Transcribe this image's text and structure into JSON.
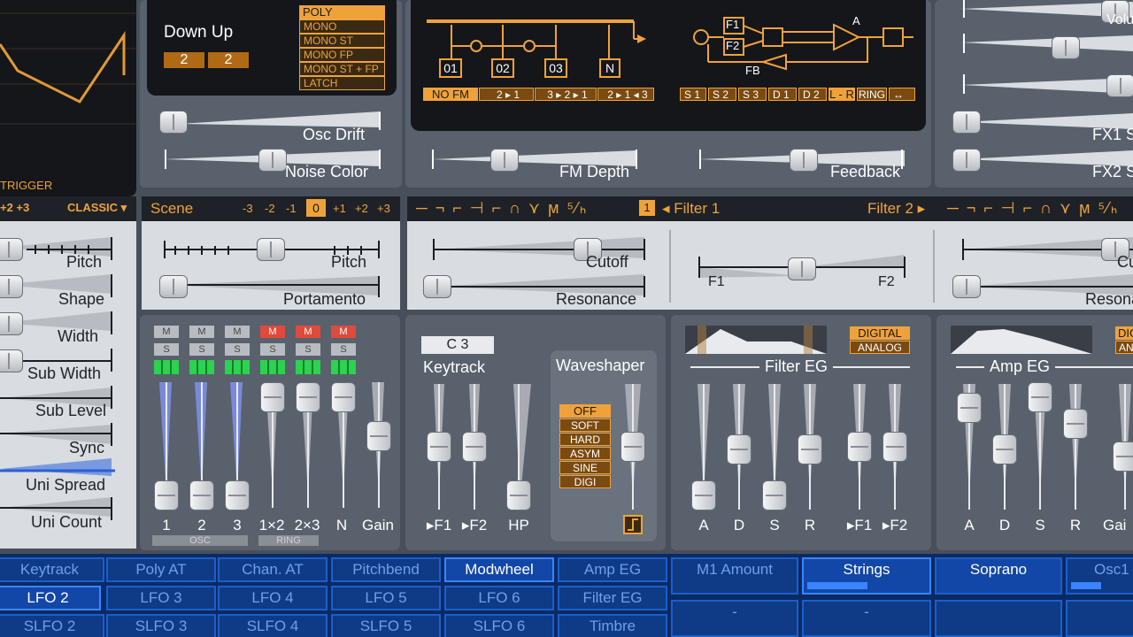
{
  "osc_display": {
    "trigger_label": "TRIGGER"
  },
  "playmode": {
    "title": "Down Up",
    "values": [
      "2",
      "2"
    ],
    "modes": [
      "POLY",
      "MONO",
      "MONO ST",
      "MONO FP",
      "MONO ST + FP",
      "LATCH"
    ],
    "selected": "POLY"
  },
  "osc_sliders": {
    "drift_label": "Osc Drift",
    "noise_label": "Noise Color"
  },
  "fm": {
    "routing": [
      "NO FM",
      "2 ▸ 1",
      "3 ▸ 2 ▸ 1",
      "2 ▸ 1 ◂ 3"
    ],
    "osc_boxes": [
      "01",
      "02",
      "03",
      "N"
    ],
    "filter_config": [
      "S 1",
      "S 2",
      "S 3",
      "D 1",
      "D 2",
      "L - R",
      "RING",
      "↔"
    ],
    "f1": "F1",
    "f2": "F2",
    "fb": "FB",
    "a": "A",
    "depth_label": "FM Depth",
    "feedback_label": "Feedback"
  },
  "right_fx": {
    "labels": [
      "Volu",
      "FX1 S",
      "FX2 S"
    ]
  },
  "left_strip": {
    "octave": "+2 +3",
    "type": "CLASSIC ▾",
    "sliders": [
      "Pitch",
      "Shape",
      "Width",
      "Sub Width",
      "Sub Level",
      "Sync",
      "Uni Spread",
      "Uni Count"
    ]
  },
  "scene": {
    "title": "Scene",
    "octaves": [
      "-3",
      "-2",
      "-1",
      "0",
      "+1",
      "+2",
      "+3"
    ],
    "selected": "0",
    "pitch_label": "Pitch",
    "portamento_label": "Portamento"
  },
  "filter_bar": {
    "filter1_icons": "─ ¬ ⌐ ⊣ ⌐ ∩ ⋎ ϻ ⁵⁄ₕ",
    "num": "1",
    "filter1_label": "◂ Filter 1",
    "filter2_label": "Filter 2 ▸",
    "filter2_icons": "─ ¬ ⌐ ⊣ ⌐ ∩ ⋎ ϻ ⁵⁄ₕ",
    "cutoff_label": "Cutoff",
    "resonance_label": "Resonance",
    "f1": "F1",
    "f2": "F2",
    "cutoff2_label": "Cu",
    "resonance2_label": "Resona"
  },
  "mixer": {
    "m_labels": [
      "M",
      "M",
      "M",
      "M",
      "M",
      "M"
    ],
    "s_labels": [
      "S",
      "S",
      "S",
      "S",
      "S",
      "S"
    ],
    "channels": [
      "1",
      "2",
      "3",
      "1×2",
      "2×3",
      "N",
      "Gain"
    ],
    "group1": "OSC",
    "group2": "RING"
  },
  "keytrack": {
    "note": "C 3",
    "title": "Keytrack",
    "labels": [
      "▸F1",
      "▸F2",
      "HP"
    ]
  },
  "waveshaper": {
    "title": "Waveshaper",
    "modes": [
      "OFF",
      "SOFT",
      "HARD",
      "ASYM",
      "SINE",
      "DIGI"
    ],
    "selected": "OFF"
  },
  "filter_eg": {
    "title": "Filter EG",
    "modes": [
      "DIGITAL",
      "ANALOG"
    ],
    "labels": [
      "A",
      "D",
      "S",
      "R",
      "▸F1",
      "▸F2"
    ]
  },
  "amp_eg": {
    "title": "Amp EG",
    "modes": [
      "DIGI",
      "AN"
    ],
    "labels": [
      "A",
      "D",
      "S",
      "R",
      "Gai"
    ]
  },
  "mod_matrix": {
    "row1": [
      "Keytrack",
      "Poly AT",
      "Chan. AT",
      "Pitchbend",
      "Modwheel",
      "Amp EG",
      "M1 Amount",
      "Strings",
      "Soprano",
      "Osc1"
    ],
    "row2": [
      "LFO 2",
      "LFO 3",
      "LFO 4",
      "LFO 5",
      "LFO 6",
      "Filter EG"
    ],
    "row3": [
      "SLFO 2",
      "SLFO 3",
      "SLFO 4",
      "SLFO 5",
      "SLFO 6",
      "Timbre"
    ],
    "row3_dashes": [
      "-",
      "-"
    ],
    "selected_row1": "Modwheel"
  }
}
